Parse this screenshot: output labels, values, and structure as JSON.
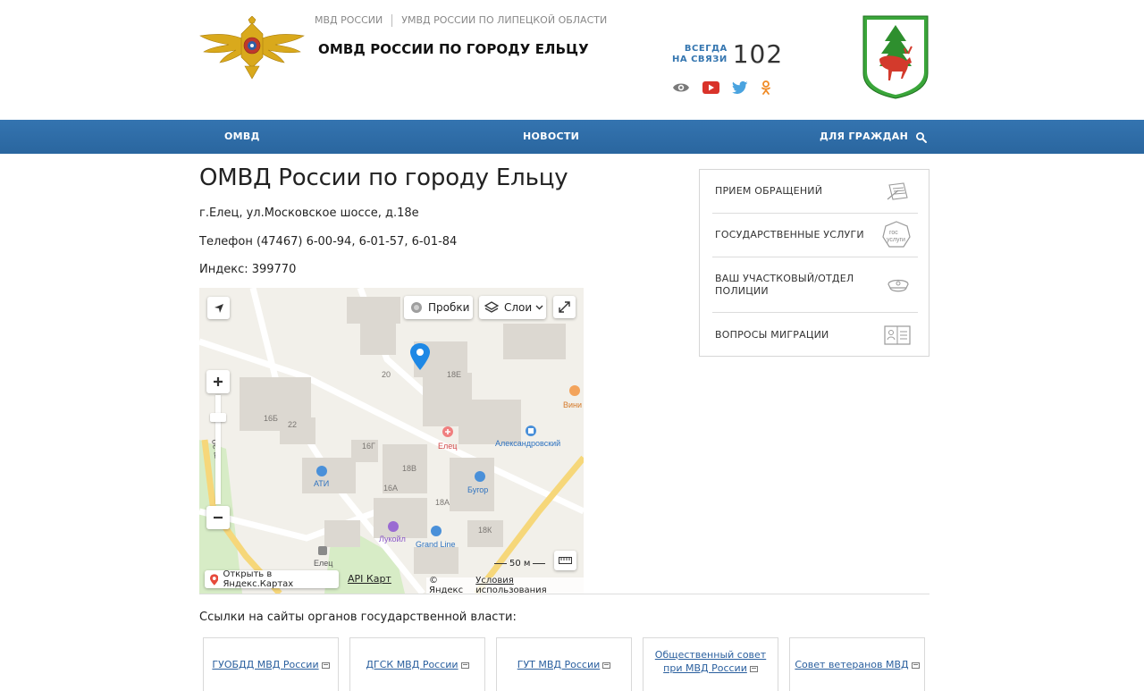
{
  "header": {
    "breadcrumbs": [
      "МВД РОССИИ",
      "УМВД РОССИИ ПО ЛИПЕЦКОЙ ОБЛАСТИ"
    ],
    "site_title": "ОМВД РОССИИ ПО ГОРОДУ ЕЛЬЦУ",
    "hotline_label_1": "ВСЕГДА",
    "hotline_label_2": "НА СВЯЗИ",
    "hotline_number": "102",
    "social_icons": [
      "eye-icon",
      "youtube-icon",
      "twitter-icon",
      "odnoklassniki-icon"
    ]
  },
  "nav": {
    "items": [
      "ОМВД",
      "НОВОСТИ",
      "ДЛЯ ГРАЖДАН"
    ],
    "search_icon": "search-icon"
  },
  "main": {
    "title": "ОМВД России по городу Ельцу",
    "address": "г.Елец, ул.Московское шоссе, д.18е",
    "phone": "Телефон (47467) 6-00-94, 6-01-57, 6-01-84",
    "index": "Индекс: 399770"
  },
  "map": {
    "traffic_label": "Пробки",
    "layers_label": "Слои",
    "open_yandex": "Открыть в Яндекс.Картах",
    "api_label": "API Карт",
    "copyright": "© Яндекс",
    "terms": "Условия использования",
    "scale": "50 м",
    "labels": {
      "b20": "20",
      "b18e": "18Е",
      "b16b": "16Б",
      "b22": "22",
      "b16g": "16Г",
      "b18v": "18В",
      "b16a": "16А",
      "b18a": "18А",
      "b18k": "18К",
      "elets_pharm": "Елец",
      "alexandrovsky": "Александровский",
      "vini": "Вини",
      "ati": "АТИ",
      "bugor": "Бугор",
      "lukoil": "Лукойл",
      "grandline": "Grand Line",
      "elets_bus": "Елец",
      "road": "ое ш."
    }
  },
  "sidebar": {
    "items": [
      {
        "label": "ПРИЕМ ОБРАЩЕНИЙ",
        "icon": "document-pen-icon"
      },
      {
        "label": "ГОСУДАРСТВЕННЫЕ УСЛУГИ",
        "icon": "gosuslugi-icon",
        "icon_text_1": "гос",
        "icon_text_2": "услуги"
      },
      {
        "label_1": "ВАШ УЧАСТКОВЫЙ/ОТДЕЛ",
        "label_2": "ПОЛИЦИИ",
        "icon": "police-cap-icon"
      },
      {
        "label": "ВОПРОСЫ МИГРАЦИИ",
        "icon": "passport-icon"
      }
    ]
  },
  "links": {
    "title": "Ссылки на сайты органов государственной власти:",
    "cards": [
      {
        "line1": "ГУОБДД МВД России"
      },
      {
        "line1": "ДГСК МВД России"
      },
      {
        "line1": "ГУТ МВД России"
      },
      {
        "line1": "Общественный совет",
        "line2": "при МВД России"
      },
      {
        "line1": "Совет ветеранов МВД"
      }
    ]
  }
}
